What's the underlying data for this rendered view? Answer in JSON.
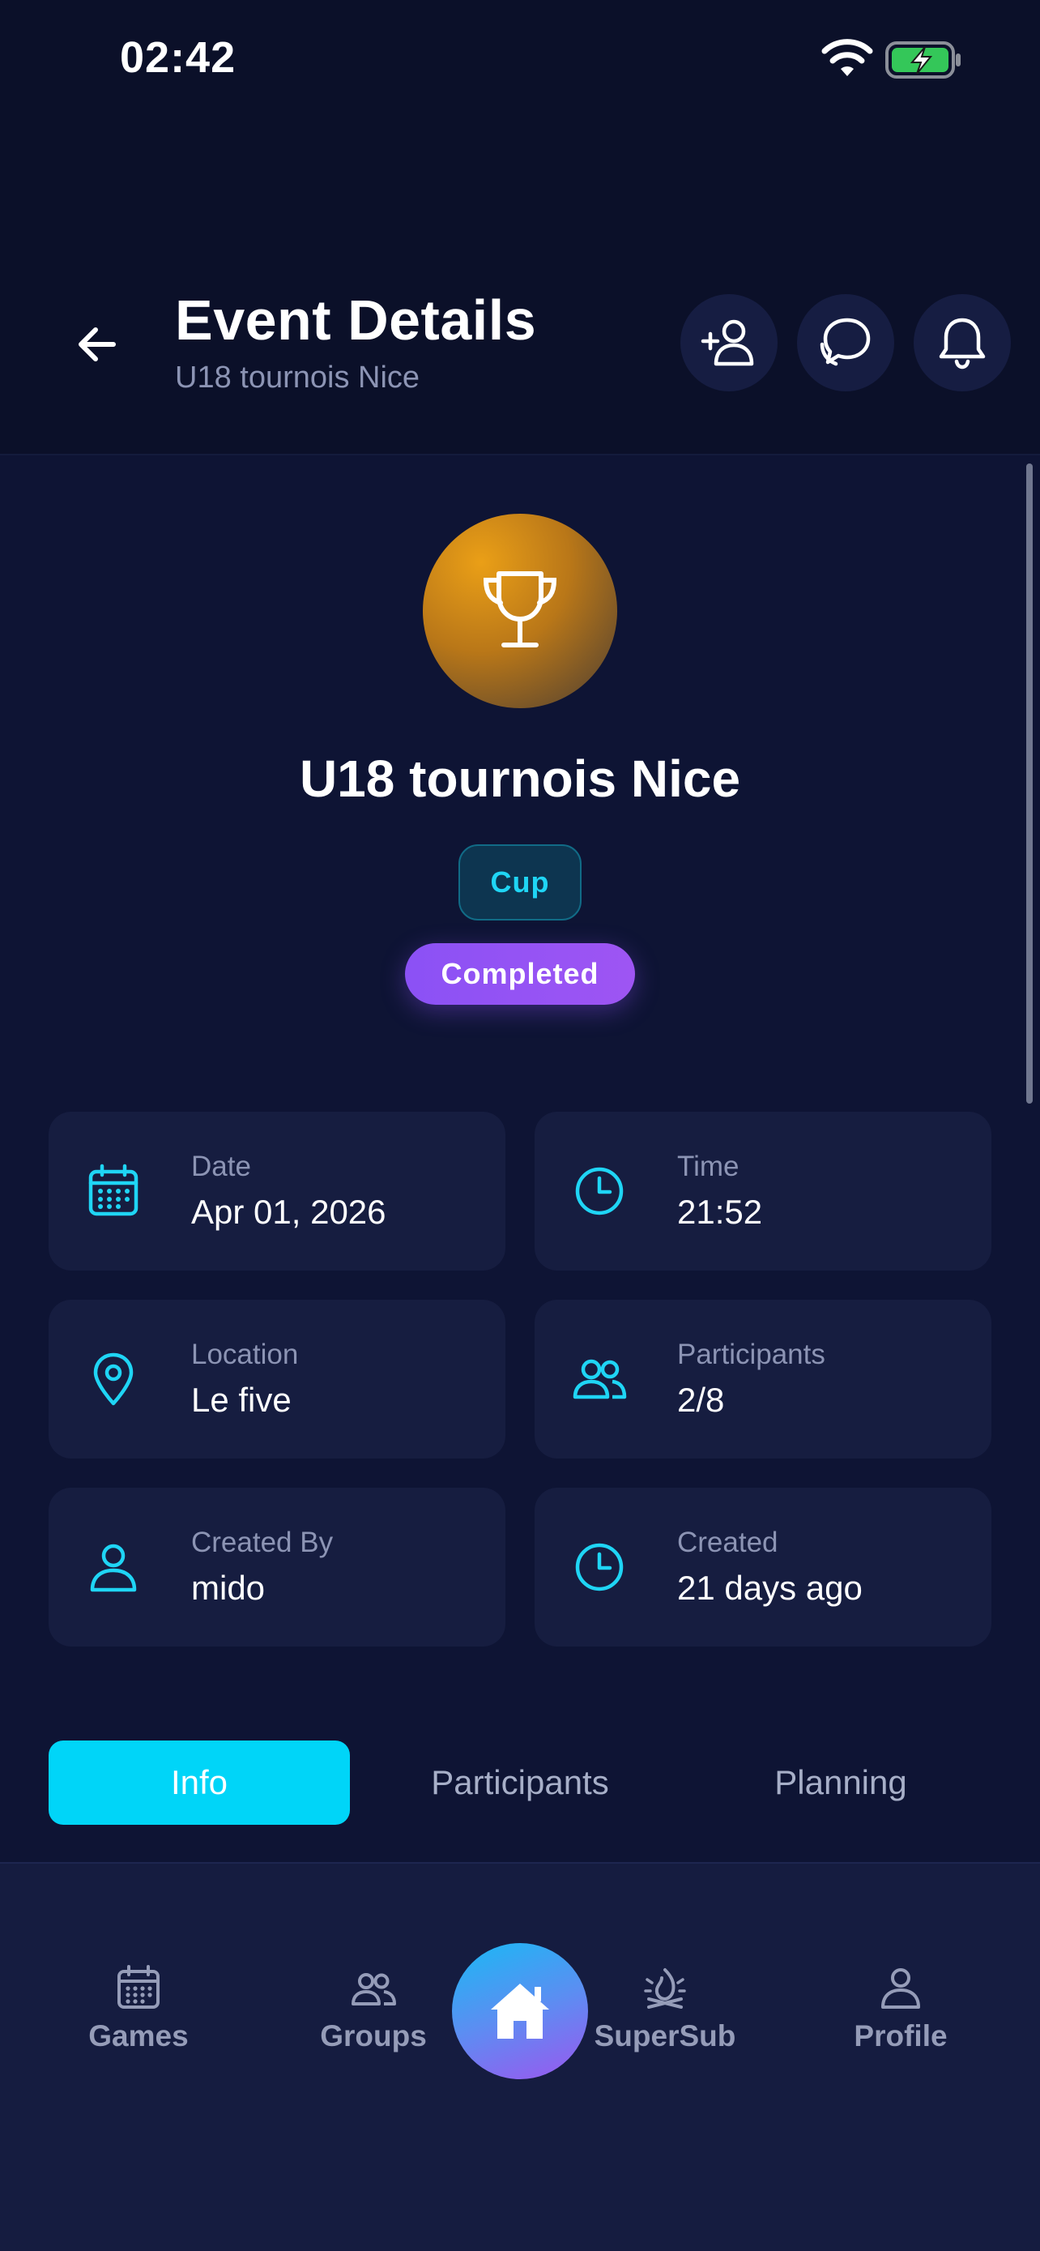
{
  "status_bar": {
    "time": "02:42"
  },
  "header": {
    "title": "Event Details",
    "subtitle": "U18 tournois Nice",
    "actions": [
      "add-user-icon",
      "chat-icon",
      "bell-icon"
    ]
  },
  "event": {
    "icon": "trophy-icon",
    "name": "U18 tournois Nice",
    "type": "Cup",
    "status": "Completed"
  },
  "info_cards": [
    {
      "icon": "calendar-icon",
      "label": "Date",
      "value": "Apr 01, 2026"
    },
    {
      "icon": "clock-icon",
      "label": "Time",
      "value": "21:52"
    },
    {
      "icon": "location-pin-icon",
      "label": "Location",
      "value": "Le five"
    },
    {
      "icon": "participants-icon",
      "label": "Participants",
      "value": "2/8"
    },
    {
      "icon": "user-icon",
      "label": "Created By",
      "value": "mido"
    },
    {
      "icon": "clock-icon",
      "label": "Created",
      "value": "21 days ago"
    }
  ],
  "tabs": [
    {
      "label": "Info",
      "active": true
    },
    {
      "label": "Participants",
      "active": false
    },
    {
      "label": "Planning",
      "active": false
    }
  ],
  "bottom_nav": {
    "items": [
      {
        "label": "Games",
        "icon": "calendar-icon"
      },
      {
        "label": "Groups",
        "icon": "groups-icon"
      },
      {
        "label": "SuperSub",
        "icon": "supersub-icon"
      },
      {
        "label": "Profile",
        "icon": "profile-icon"
      }
    ],
    "home_icon": "home-icon"
  },
  "colors": {
    "background": "#0b1029",
    "surface": "#161d40",
    "accent": "#00d5f8",
    "purple": "#8b51f5",
    "muted_text": "#8c94b4"
  }
}
